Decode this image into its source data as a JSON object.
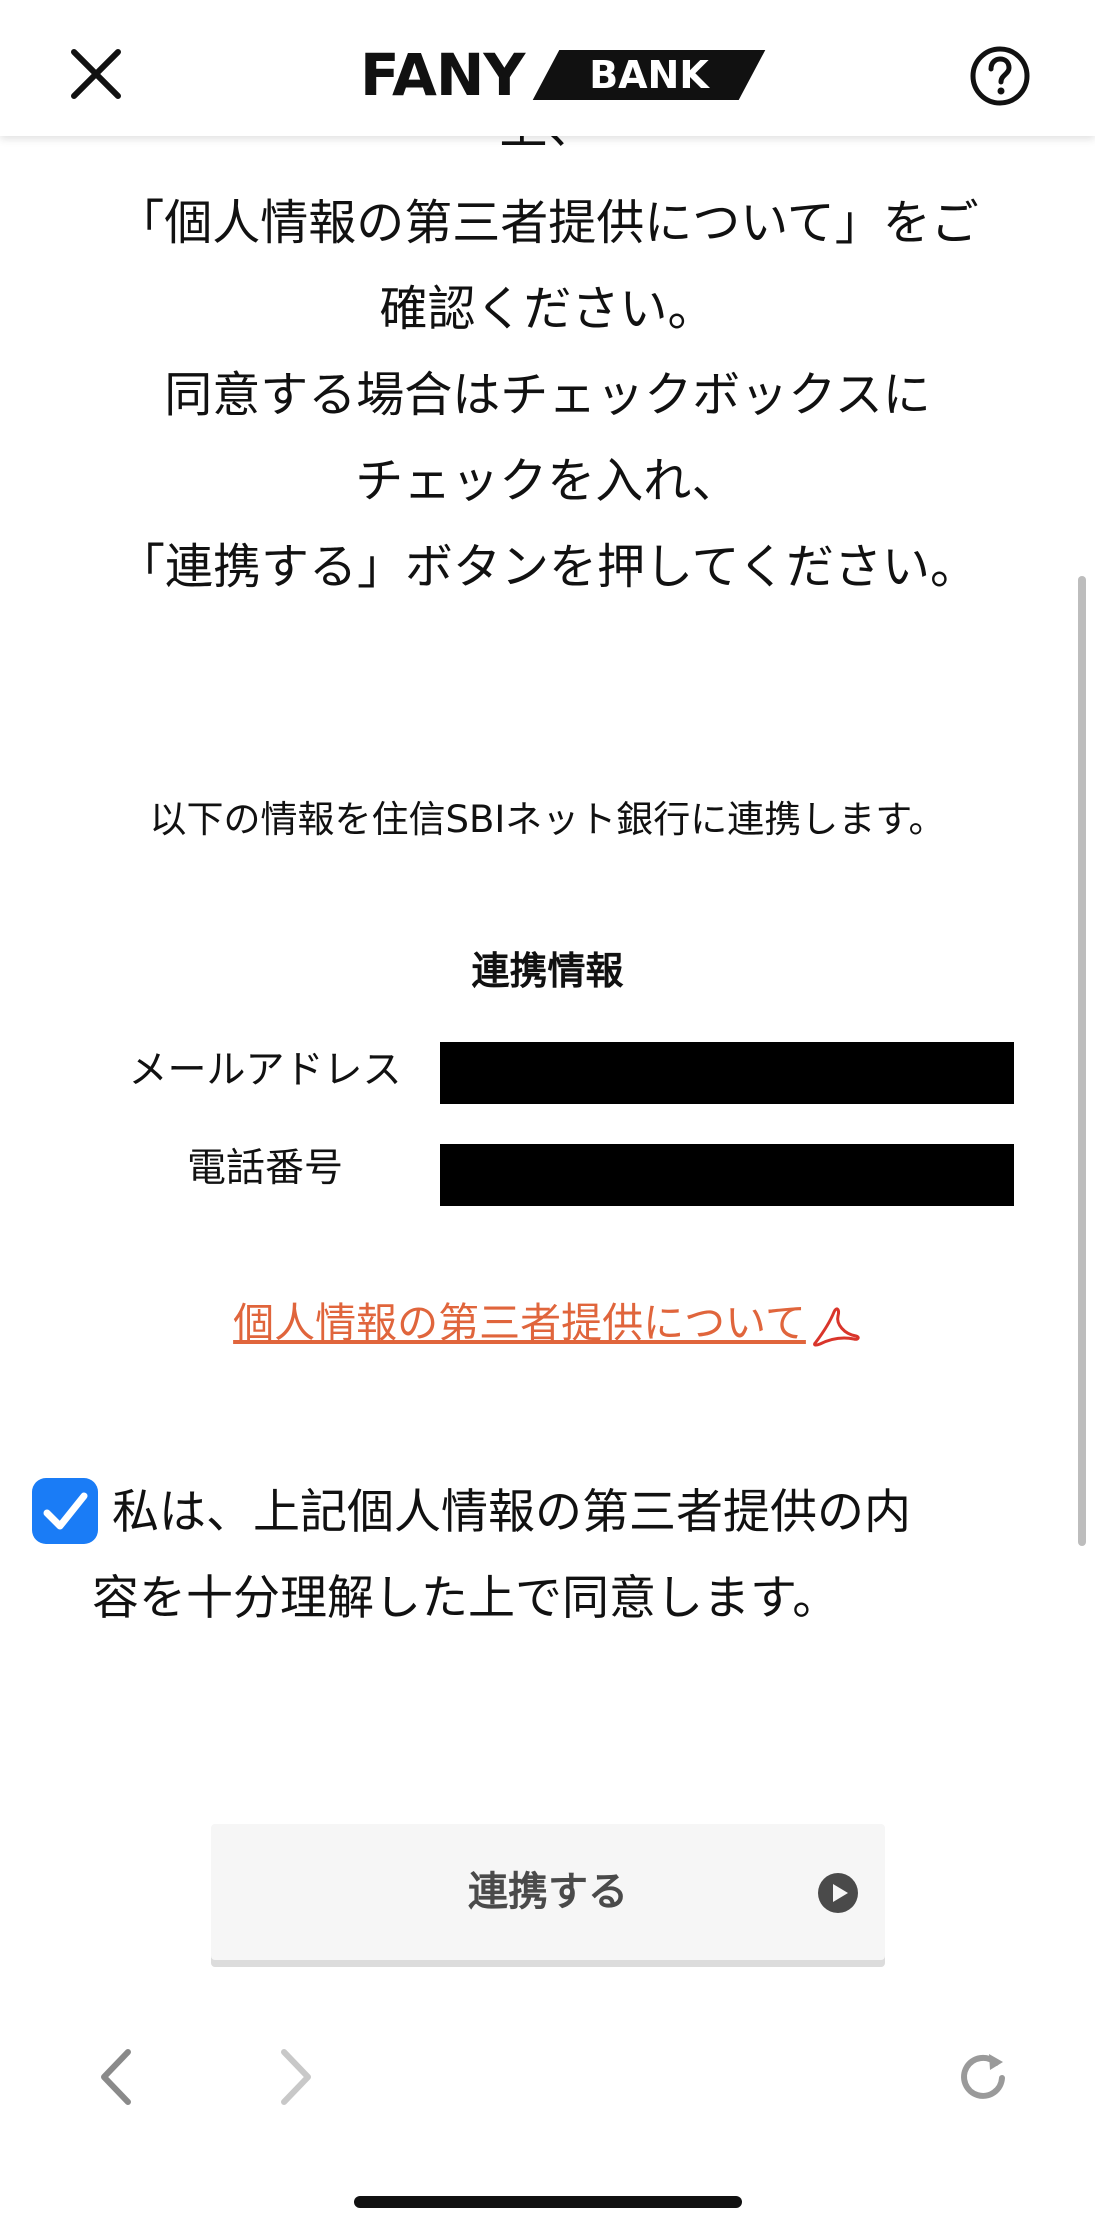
{
  "header": {
    "logo": {
      "fany": "FANY",
      "bank": "BANK"
    }
  },
  "instructions": {
    "partial_top": "上、",
    "lines": [
      "「個人情報の第三者提供について」をご",
      "確認ください。",
      "同意する場合はチェックボックスに",
      "チェックを入れ、",
      "「連携する」ボタンを押してください。"
    ]
  },
  "intro": "以下の情報を住信SBIネット銀行に連携します。",
  "link_info": {
    "title": "連携情報",
    "fields": [
      {
        "label": "メールアドレス"
      },
      {
        "label": "電話番号"
      }
    ]
  },
  "pdf_link": {
    "label": "個人情報の第三者提供について"
  },
  "consent": {
    "checked": true,
    "line1": "私は、上記個人情報の第三者提供の内",
    "line2": "容を十分理解した上で同意します。"
  },
  "primary_button": {
    "label": "連携する"
  },
  "colors": {
    "link": "#e0653c",
    "checkbox": "#1a7cf6",
    "redaction": "#000000"
  }
}
